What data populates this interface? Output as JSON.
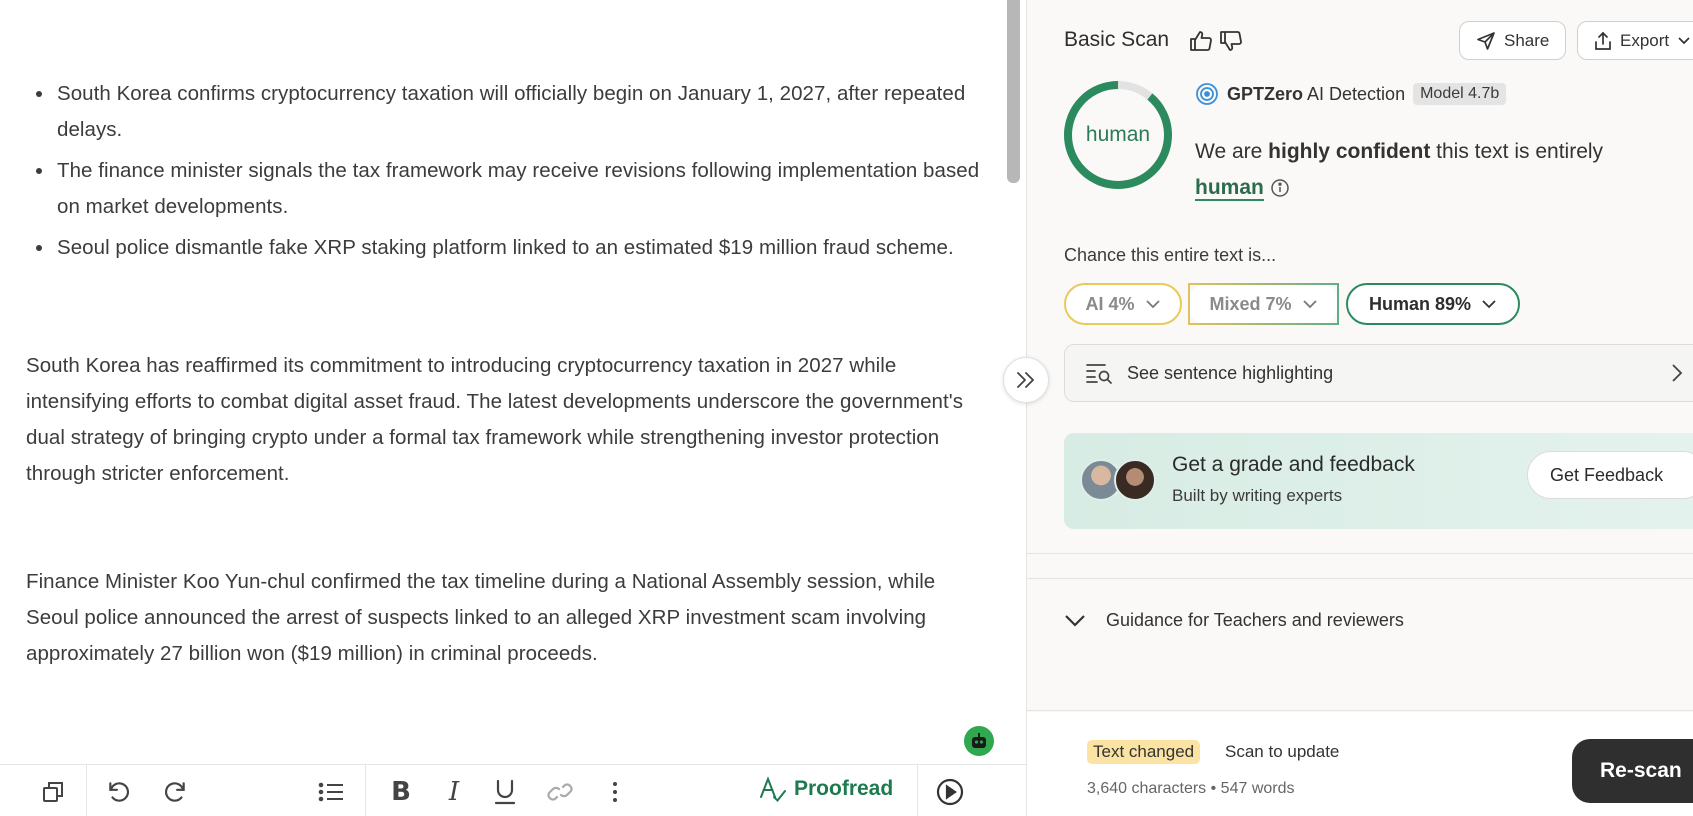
{
  "editor": {
    "bullets": [
      "South Korea confirms cryptocurrency taxation will officially begin on January 1, 2027, after repeated delays.",
      "The finance minister signals the tax framework may receive revisions following implementation based on market developments.",
      "Seoul police dismantle fake XRP staking platform linked to an estimated $19 million fraud scheme."
    ],
    "paragraph1": "South Korea has reaffirmed its commitment to introducing cryptocurrency taxation in 2027 while intensifying efforts to combat digital asset fraud. The latest developments underscore the government's dual strategy of bringing crypto under a formal tax framework while strengthening investor protection through stricter enforcement.",
    "paragraph2": "Finance Minister Koo Yun-chul confirmed the tax timeline during a National Assembly session, while Seoul police announced the arrest of suspects linked to an alleged XRP investment scam involving approximately 27 billion won ($19 million) in criminal proceeds."
  },
  "toolbar": {
    "proofread_label": "Proofread"
  },
  "panel": {
    "title": "Basic Scan",
    "share_label": "Share",
    "export_label": "Export",
    "ring": {
      "label": "human",
      "human_fraction": 0.89,
      "color_human": "#2b8a5e",
      "color_rest": "#e2e2e2"
    },
    "detection": {
      "brand": "GPTZero",
      "product": "AI Detection",
      "model": "Model 4.7b",
      "confidence_prefix": "We are",
      "confidence_strong": "highly confident",
      "confidence_suffix": "this text is entirely",
      "verdict": "human"
    },
    "chance_label": "Chance this entire text is...",
    "chips": {
      "ai": "AI 4%",
      "mixed": "Mixed 7%",
      "human": "Human 89%"
    },
    "highlight_label": "See sentence highlighting",
    "feedback": {
      "title": "Get a grade and feedback",
      "subtitle": "Built by writing experts",
      "button": "Get Feedback"
    },
    "guidance_label": "Guidance for Teachers and reviewers",
    "status": {
      "badge": "Text changed",
      "hint": "Scan to update",
      "counts": "3,640 characters • 547 words",
      "rescan_label": "Re-scan"
    }
  }
}
